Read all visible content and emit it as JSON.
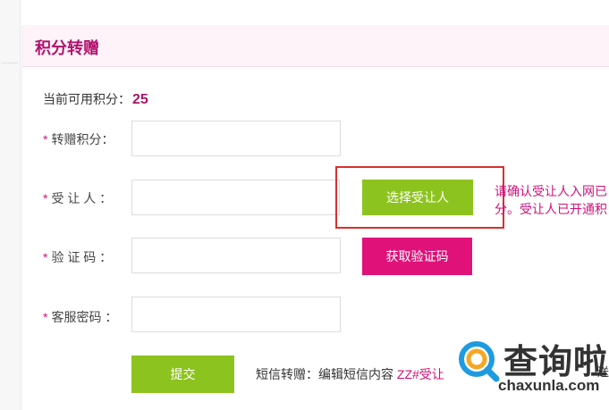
{
  "header": {
    "title": "积分转赠"
  },
  "points": {
    "label": "当前可用积分：",
    "value": "25"
  },
  "form": {
    "required_mark": "*",
    "transfer_points_label": "转赠积分：",
    "recipient_label": "受 让 人 ：",
    "verify_code_label": "验 证 码 ：",
    "service_password_label": "客服密码 ：",
    "transfer_points_value": "",
    "recipient_value": "",
    "verify_code_value": "",
    "service_password_value": ""
  },
  "buttons": {
    "select_recipient": "选择受让人",
    "get_code": "获取验证码",
    "submit": "提交"
  },
  "notice": {
    "line1": "请确认受让人入网已",
    "line2": "分。受让人已开通积"
  },
  "sms": {
    "prefix": "短信转赠：编辑短信内容 ",
    "code": "ZZ#受让"
  },
  "watermark": {
    "name": "查询啦",
    "domain": "chaxunla.com",
    "extra": "送"
  },
  "colors": {
    "brand": "#b3126f",
    "accent_pink": "#e0127a",
    "green": "#8dc31f",
    "highlight_red": "#d9302e"
  }
}
